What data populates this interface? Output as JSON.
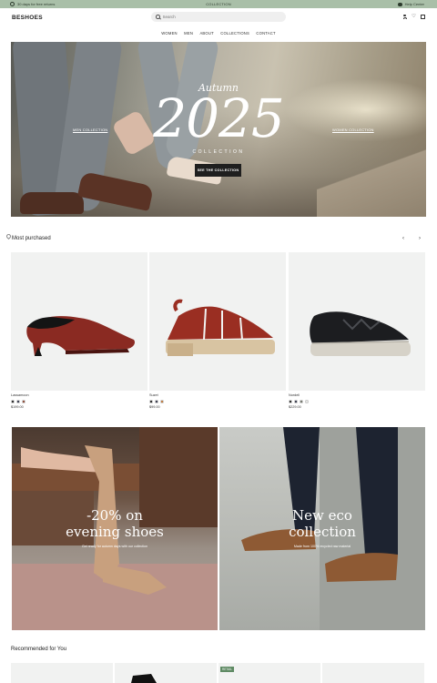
{
  "announcement": {
    "left_text": "30 days for free returns",
    "center_text": "COLLECTION",
    "right_text": "Help Center"
  },
  "header": {
    "logo": "BESHOES",
    "search_placeholder": "Search"
  },
  "nav": {
    "items": [
      "WOMEN",
      "MEN",
      "ABOUT",
      "COLLECTIONS",
      "CONTACT"
    ]
  },
  "hero": {
    "season": "Autumn",
    "year": "2025",
    "collection": "COLLECTION",
    "button": "SEE THE COLLECTION",
    "men_link": "MEN COLLECTION",
    "women_link": "WOMEN COLLECTION"
  },
  "most_purchased": {
    "title": "Most purchased",
    "products": [
      {
        "name": "Lassamoon",
        "price": "$199.00",
        "swatches": [
          "#1a1a1a",
          "#2b2f44",
          "#8a3f2a"
        ]
      },
      {
        "name": "Suzet",
        "price": "$99.00",
        "swatches": [
          "#1a1a1a",
          "#2b2f44",
          "#c0712e"
        ]
      },
      {
        "name": "Nordell",
        "price": "$229.00",
        "swatches": [
          "#1a1a1a",
          "#2b2f44",
          "#6a6e62",
          "#e8e8e6"
        ]
      }
    ]
  },
  "promos": [
    {
      "line1": "-20% on",
      "line2": "evening shoes",
      "sub": "Get ready for autumn days with our collection"
    },
    {
      "line1": "New eco",
      "line2": "collection",
      "sub": "Made from 100% recycled raw material"
    }
  ],
  "recommended": {
    "title": "Recommended for You",
    "badge": "RETAIL"
  }
}
